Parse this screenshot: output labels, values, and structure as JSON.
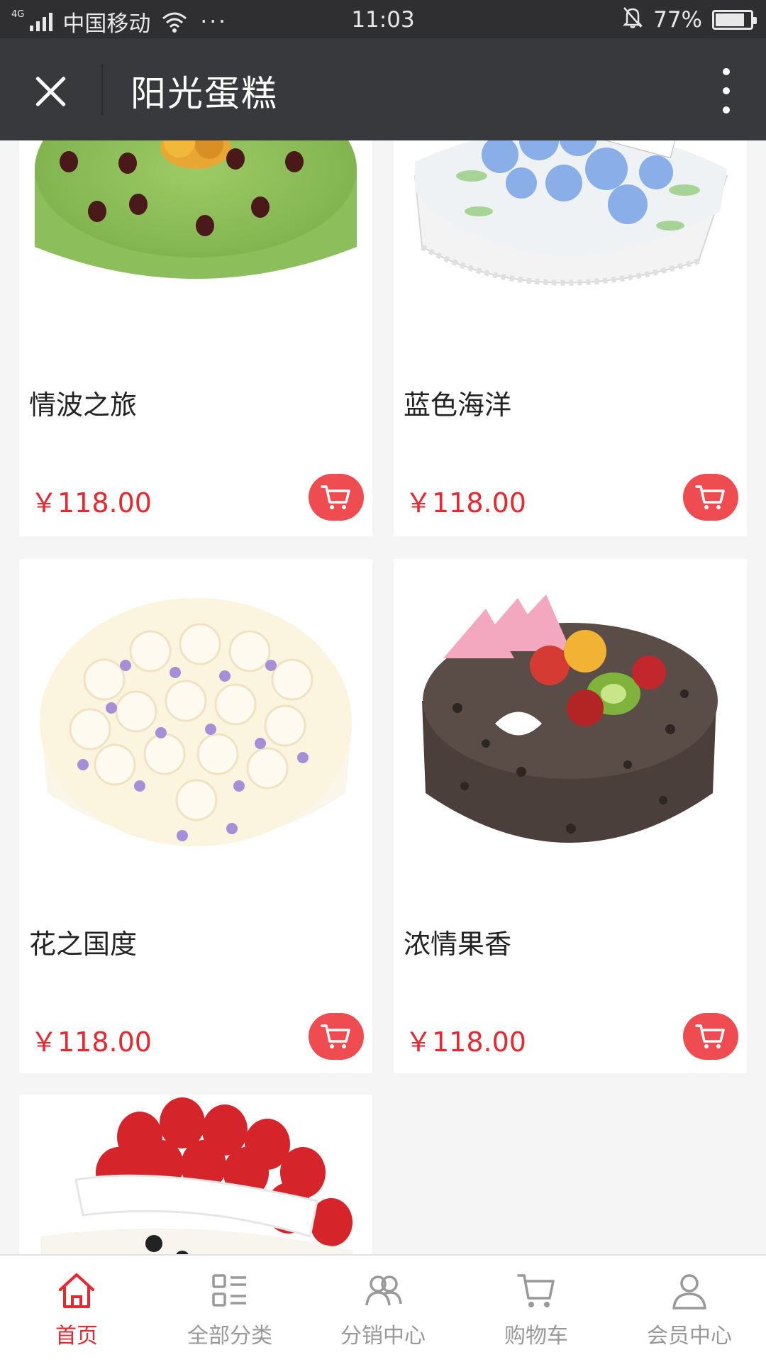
{
  "status_bar": {
    "network": "4G",
    "carrier": "中国移动",
    "dots": "···",
    "time": "11:03",
    "battery": "77%",
    "battery_level": 0.77
  },
  "nav": {
    "title": "阳光蛋糕"
  },
  "products": [
    {
      "name": "情波之旅",
      "price": "￥118.00"
    },
    {
      "name": "蓝色海洋",
      "price": "￥118.00"
    },
    {
      "name": "花之国度",
      "price": "￥118.00"
    },
    {
      "name": "浓情果香",
      "price": "￥118.00"
    }
  ],
  "tabs": [
    {
      "label": "首页",
      "icon": "home-icon",
      "active": true
    },
    {
      "label": "全部分类",
      "icon": "category-list-icon",
      "active": false
    },
    {
      "label": "分销中心",
      "icon": "distribution-icon",
      "active": false
    },
    {
      "label": "购物车",
      "icon": "cart-icon",
      "active": false
    },
    {
      "label": "会员中心",
      "icon": "member-icon",
      "active": false
    }
  ],
  "colors": {
    "accent": "#e8272e",
    "cart_button": "#ef4c51",
    "nav_bg": "#38393d",
    "status_bg": "#2f2f31"
  }
}
